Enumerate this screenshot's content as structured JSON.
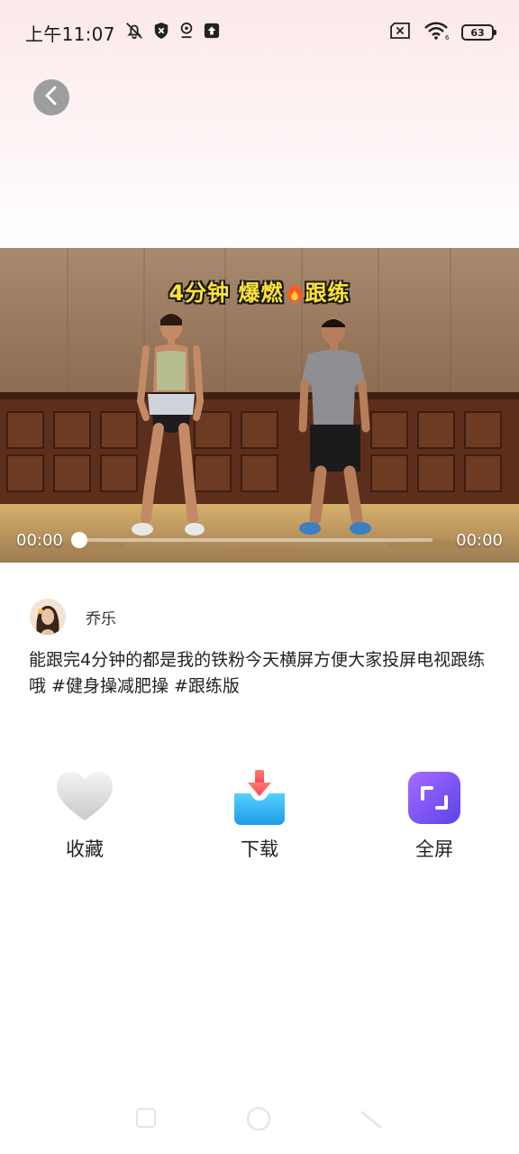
{
  "status_bar": {
    "time": "上午11:07",
    "battery": "63"
  },
  "video": {
    "title_text": "4分钟 爆燃",
    "title_suffix": "跟练",
    "current_time": "00:00",
    "total_time": "00:00",
    "progress_fraction": 0
  },
  "author": {
    "name": "乔乐"
  },
  "description": "能跟完4分钟的都是我的铁粉今天横屏方便大家投屏电视跟练哦   #健身操减肥操 #跟练版",
  "actions": {
    "favorite_label": "收藏",
    "download_label": "下载",
    "fullscreen_label": "全屏"
  },
  "colors": {
    "header_tint": "#fbe8ea",
    "title_yellow": "#ffe23a",
    "download_blue": "#2fb3f2",
    "download_red": "#ff5b5b",
    "fullscreen_purple": "#7b4df0"
  },
  "icons": {
    "back": "back-arrow-icon",
    "favorite": "heart-icon",
    "download": "download-tray-icon",
    "fullscreen": "fullscreen-icon",
    "fire": "fire-icon"
  }
}
